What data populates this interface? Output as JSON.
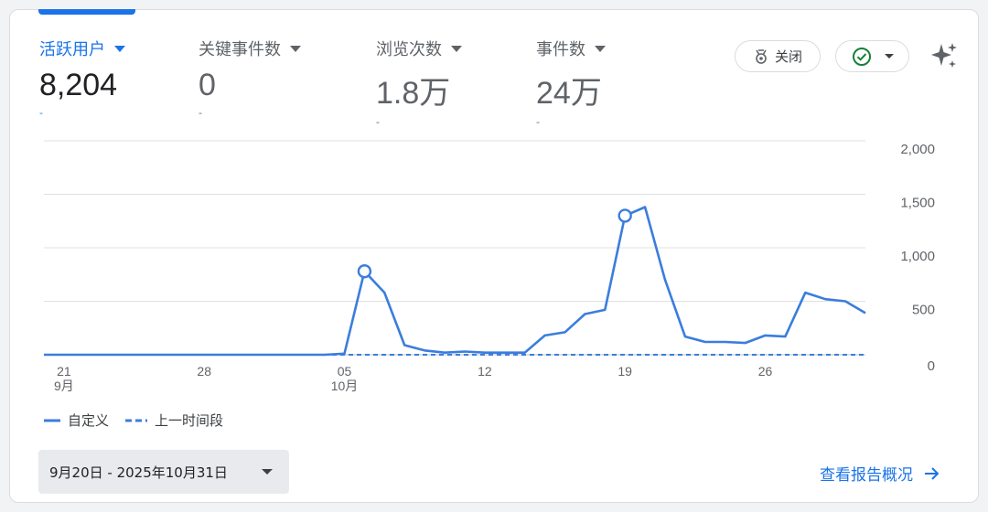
{
  "metrics": [
    {
      "label": "活跃用户",
      "value": "8,204",
      "sub": "-",
      "active": true
    },
    {
      "label": "关键事件数",
      "value": "0",
      "sub": "-",
      "active": false
    },
    {
      "label": "浏览次数",
      "value": "1.8万",
      "sub": "-",
      "active": false
    },
    {
      "label": "事件数",
      "value": "24万",
      "sub": "-",
      "active": false
    }
  ],
  "controls": {
    "close_label": "关闭",
    "close_icon": "medal-icon",
    "status_icon": "check-circle-icon",
    "insights_icon": "sparkle-icon"
  },
  "legend": {
    "current": "自定义",
    "previous": "上一时间段"
  },
  "date_range": "9月20日 - 2025年10月31日",
  "view_report": "查看报告概况",
  "colors": {
    "accent": "#1a73e8",
    "series": "#3b7ddd",
    "grid": "#e0e0e0",
    "check": "#188038"
  },
  "chart_data": {
    "type": "line",
    "x_start": "2025-09-20",
    "y_ticks": [
      "2,000",
      "1,500",
      "1,000",
      "500",
      "0"
    ],
    "ylim": [
      0,
      2000
    ],
    "y_axis_position": "right",
    "x_tick_labels": [
      {
        "date": "2025-09-21",
        "label": "21",
        "sub": "9月"
      },
      {
        "date": "2025-09-28",
        "label": "28",
        "sub": ""
      },
      {
        "date": "2025-10-05",
        "label": "05",
        "sub": "10月"
      },
      {
        "date": "2025-10-12",
        "label": "12",
        "sub": ""
      },
      {
        "date": "2025-10-19",
        "label": "19",
        "sub": ""
      },
      {
        "date": "2025-10-26",
        "label": "26",
        "sub": ""
      }
    ],
    "series": [
      {
        "name": "自定义",
        "style": "solid",
        "values": [
          0,
          0,
          0,
          0,
          0,
          0,
          0,
          0,
          0,
          0,
          0,
          0,
          0,
          0,
          0,
          10,
          780,
          580,
          90,
          40,
          20,
          30,
          20,
          20,
          20,
          180,
          210,
          380,
          420,
          1300,
          1380,
          700,
          170,
          120,
          120,
          110,
          180,
          170,
          580,
          520,
          500,
          390
        ]
      },
      {
        "name": "上一时间段",
        "style": "dashed",
        "values": [
          0,
          0,
          0,
          0,
          0,
          0,
          0,
          0,
          0,
          0,
          0,
          0,
          0,
          0,
          0,
          0,
          0,
          0,
          0,
          0,
          0,
          0,
          0,
          0,
          0,
          0,
          0,
          0,
          0,
          0,
          0,
          0,
          0,
          0,
          0,
          0,
          0,
          0,
          0,
          0,
          0,
          0
        ]
      }
    ],
    "markers": [
      "2025-10-06",
      "2025-10-19"
    ],
    "grid": true,
    "legend_position": "bottom-left"
  }
}
